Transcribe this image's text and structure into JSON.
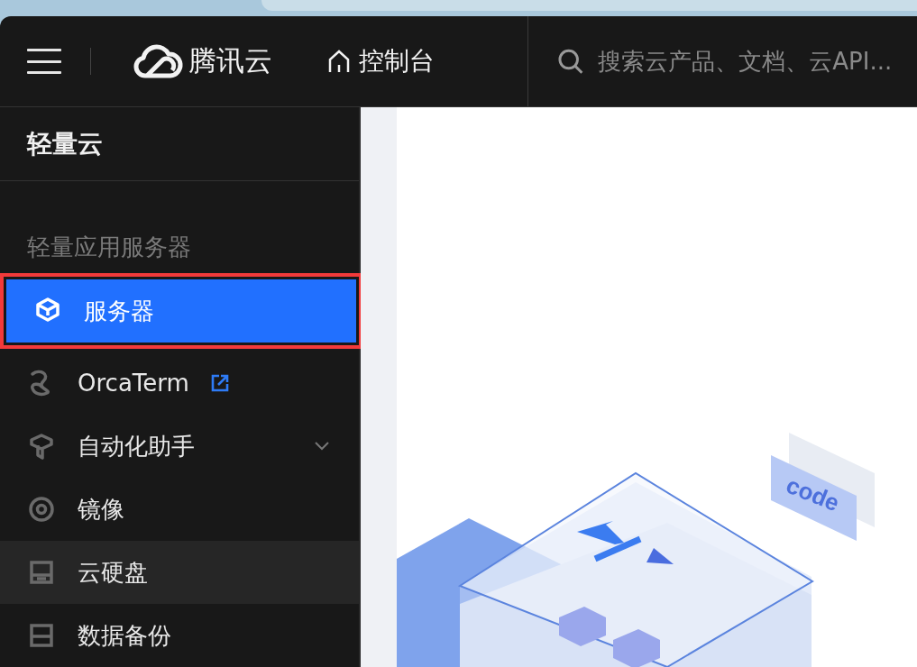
{
  "header": {
    "brand": "腾讯云",
    "console": "控制台",
    "search": {
      "placeholder": "搜索云产品、文档、云API..."
    }
  },
  "sidebar": {
    "title": "轻量云",
    "section": "轻量应用服务器",
    "items": [
      {
        "label": "服务器",
        "kind": "plain",
        "selected": true,
        "hovered": false,
        "highlighted": true
      },
      {
        "label": "OrcaTerm",
        "kind": "external",
        "selected": false,
        "hovered": false,
        "highlighted": false
      },
      {
        "label": "自动化助手",
        "kind": "expandable",
        "selected": false,
        "hovered": false,
        "highlighted": false,
        "expanded": false
      },
      {
        "label": "镜像",
        "kind": "plain",
        "selected": false,
        "hovered": false,
        "highlighted": false
      },
      {
        "label": "云硬盘",
        "kind": "plain",
        "selected": false,
        "hovered": true,
        "highlighted": false
      },
      {
        "label": "数据备份",
        "kind": "plain",
        "selected": false,
        "hovered": false,
        "highlighted": false
      }
    ]
  },
  "illustration": {
    "tag": "code"
  }
}
